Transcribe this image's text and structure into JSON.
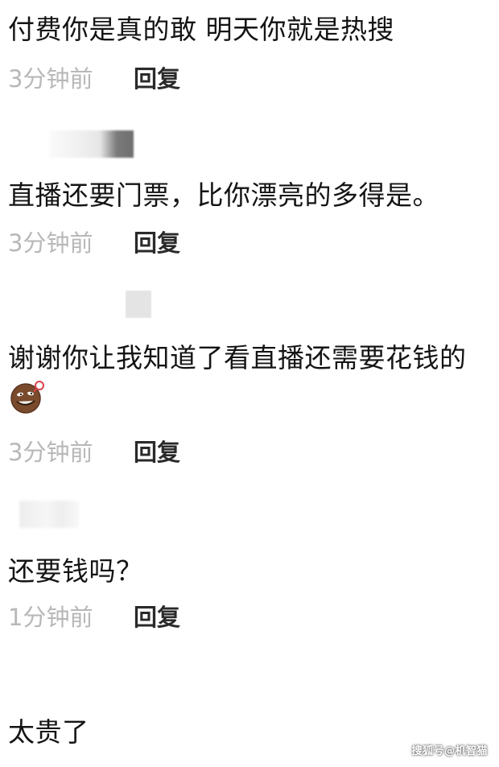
{
  "comments": [
    {
      "text": "付费你是真的敢 明天你就是热搜",
      "time": "3分钟前",
      "reply_label": "回复"
    },
    {
      "text": "直播还要门票，比你漂亮的多得是。",
      "time": "3分钟前",
      "reply_label": "回复"
    },
    {
      "text": "谢谢你让我知道了看直播还需要花钱的",
      "time": "3分钟前",
      "reply_label": "回复"
    },
    {
      "text": "还要钱吗？",
      "time": "1分钟前",
      "reply_label": "回复"
    },
    {
      "text": "太贵了"
    }
  ],
  "watermark": "搜狐号@机智猫",
  "icons": {
    "emoji": "smirk-emoji-icon"
  }
}
